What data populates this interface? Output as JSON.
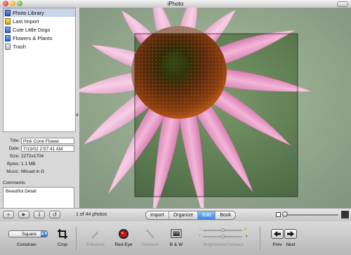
{
  "window": {
    "title": "iPhoto"
  },
  "source_list": {
    "items": [
      {
        "label": "Photo Library",
        "icon": "photo-library-icon",
        "selected": true
      },
      {
        "label": "Last Import",
        "icon": "last-import-icon",
        "selected": false
      },
      {
        "label": "Cute Little Dogs",
        "icon": "album-icon",
        "selected": false
      },
      {
        "label": "Flowers & Plants",
        "icon": "album-icon",
        "selected": false
      },
      {
        "label": "Trash",
        "icon": "trash-icon",
        "selected": false
      }
    ]
  },
  "info": {
    "title_label": "Title:",
    "title_value": "Pink Cone Flower",
    "date_label": "Date:",
    "date_value": "7/13/02  2:57:41 AM",
    "size_label": "Size:",
    "size_value": "2272x1704",
    "bytes_label": "Bytes:",
    "bytes_value": "1.1 MB",
    "music_label": "Music:",
    "music_value": "Minuet in G",
    "comments_label": "Comments:",
    "comments_value": "Beautiful Detail"
  },
  "midbar": {
    "add_glyph": "+",
    "play_glyph": "▶",
    "info_glyph": "i",
    "rotate_glyph": "↺",
    "photo_count": "1 of 44 photos",
    "modes": [
      {
        "label": "Import",
        "active": false
      },
      {
        "label": "Organize",
        "active": false
      },
      {
        "label": "Edit",
        "active": true
      },
      {
        "label": "Book",
        "active": false
      }
    ],
    "zoom_level": 0.05
  },
  "editbar": {
    "constrain_value": "Square",
    "constrain_label": "Constrain",
    "crop_label": "Crop",
    "enhance_label": "Enhance",
    "redeye_label": "Red-Eye",
    "retouch_label": "Retouch",
    "bw_label": "B & W",
    "brightness_label": "Brightness/Contrast",
    "prev_label": "Prev",
    "next_label": "Next",
    "brightness_level": 0.5,
    "contrast_level": 0.5
  },
  "colors": {
    "selection": "#c9d5ea",
    "active_mode": "#3b86e0",
    "petal": "#e79ac4",
    "cone": "#5a2a0c"
  }
}
